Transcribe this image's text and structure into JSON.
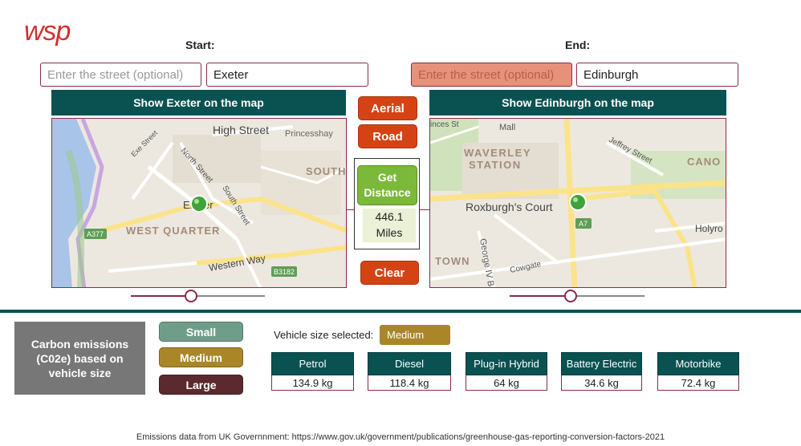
{
  "brand": {
    "logo_text": "wsp",
    "accent": "#d0312d"
  },
  "start": {
    "heading": "Start:",
    "street_placeholder": "Enter the street (optional)",
    "city_value": "Exeter",
    "show_map_label": "Show Exeter on the map",
    "map_labels": [
      "High Street",
      "Princesshay",
      "SOUTH",
      "WEST QUARTER",
      "Western Way",
      "Exeter",
      "North Street",
      "South Street",
      "Exe Street",
      "A377",
      "B3182"
    ],
    "slider_value": 0.45
  },
  "end": {
    "heading": "End:",
    "street_placeholder": "Enter the street (optional)",
    "city_value": "Edinburgh",
    "show_map_label": "Show Edinburgh on the map",
    "map_labels": [
      "Mall",
      "WAVERLEY",
      "STATION",
      "Roxburgh's Court",
      "Jeffrey Street",
      "CANO",
      "Holyro",
      "TOWN",
      "George IV B",
      "Cowgate",
      "A7",
      "inces St"
    ],
    "slider_value": 0.45
  },
  "controls": {
    "aerial_label": "Aerial",
    "road_label": "Road",
    "get_distance_label": "Get Distance",
    "distance_value": "446.1",
    "distance_unit": "Miles",
    "clear_label": "Clear"
  },
  "emissions": {
    "panel_title": "Carbon emissions (C02e) based on vehicle size",
    "sizes": [
      {
        "label": "Small",
        "color": "#6e9e8a"
      },
      {
        "label": "Medium",
        "color": "#a98628"
      },
      {
        "label": "Large",
        "color": "#5a2a2e"
      }
    ],
    "vehicle_size_label": "Vehicle size selected:",
    "vehicle_size_value": "Medium",
    "fuel_types": [
      {
        "name": "Petrol",
        "value": "134.9 kg"
      },
      {
        "name": "Diesel",
        "value": "118.4 kg"
      },
      {
        "name": "Plug-in Hybrid",
        "value": "64 kg"
      },
      {
        "name": "Battery Electric",
        "value": "34.6 kg"
      },
      {
        "name": "Motorbike",
        "value": "72.4 kg"
      }
    ]
  },
  "footer": {
    "note": "Emissions data from UK Governnment: https://www.gov.uk/government/publications/greenhouse-gas-reporting-conversion-factors-2021"
  },
  "colors": {
    "teal": "#0a5252",
    "orange": "#d54315",
    "green": "#7cb83a",
    "maroon": "#8a2a4a"
  }
}
